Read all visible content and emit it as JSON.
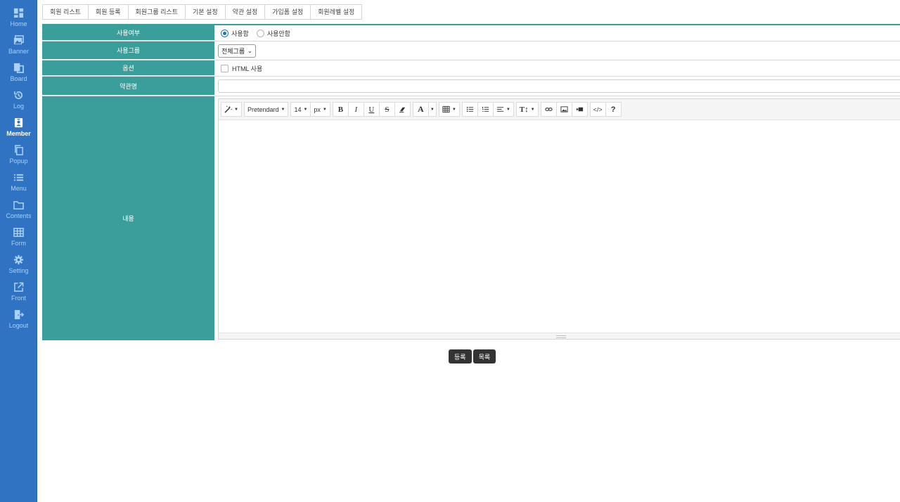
{
  "sidebar": {
    "items": [
      {
        "label": "Home",
        "icon": "dashboard-icon",
        "active": false
      },
      {
        "label": "Banner",
        "icon": "images-icon",
        "active": false
      },
      {
        "label": "Board",
        "icon": "board-icon",
        "active": false
      },
      {
        "label": "Log",
        "icon": "history-icon",
        "active": false
      },
      {
        "label": "Member",
        "icon": "member-badge-icon",
        "active": true
      },
      {
        "label": "Popup",
        "icon": "copy-icon",
        "active": false
      },
      {
        "label": "Menu",
        "icon": "list-icon",
        "active": false
      },
      {
        "label": "Contents",
        "icon": "folder-icon",
        "active": false
      },
      {
        "label": "Form",
        "icon": "table-icon",
        "active": false
      },
      {
        "label": "Setting",
        "icon": "gear-icon",
        "active": false
      },
      {
        "label": "Front",
        "icon": "external-link-icon",
        "active": false
      },
      {
        "label": "Logout",
        "icon": "logout-icon",
        "active": false
      }
    ]
  },
  "tabs": [
    "회원 리스트",
    "회원 등록",
    "회원그룹 리스트",
    "기본 설정",
    "약관 설정",
    "가입폼 설정",
    "회원레벨 설정"
  ],
  "form": {
    "use": {
      "label": "사용여부",
      "options": [
        "사용함",
        "사용안함"
      ],
      "selected": "사용함"
    },
    "group": {
      "label": "사용그룹",
      "value": "전체그룹"
    },
    "option": {
      "label": "옵션",
      "checkbox_label": "HTML 사용",
      "checked": false
    },
    "title": {
      "label": "약관명",
      "value": ""
    },
    "content": {
      "label": "내용"
    }
  },
  "editor": {
    "font": "Pretendard",
    "size": "14",
    "unit": "px",
    "toolbar_icons": [
      "magic-icon",
      "bold-icon",
      "italic-icon",
      "underline-icon",
      "strikethrough-icon",
      "eraser-icon",
      "font-color-icon",
      "table-icon",
      "unordered-list-icon",
      "ordered-list-icon",
      "align-icon",
      "line-height-icon",
      "link-icon",
      "picture-icon",
      "video-icon",
      "code-view-icon",
      "help-icon"
    ]
  },
  "actions": {
    "submit": "등록",
    "list": "목록"
  },
  "colors": {
    "sidebar": "#2f73c2",
    "header_cell": "#3a9f9a",
    "button": "#333333",
    "radio_checked": "#1a73c9"
  }
}
